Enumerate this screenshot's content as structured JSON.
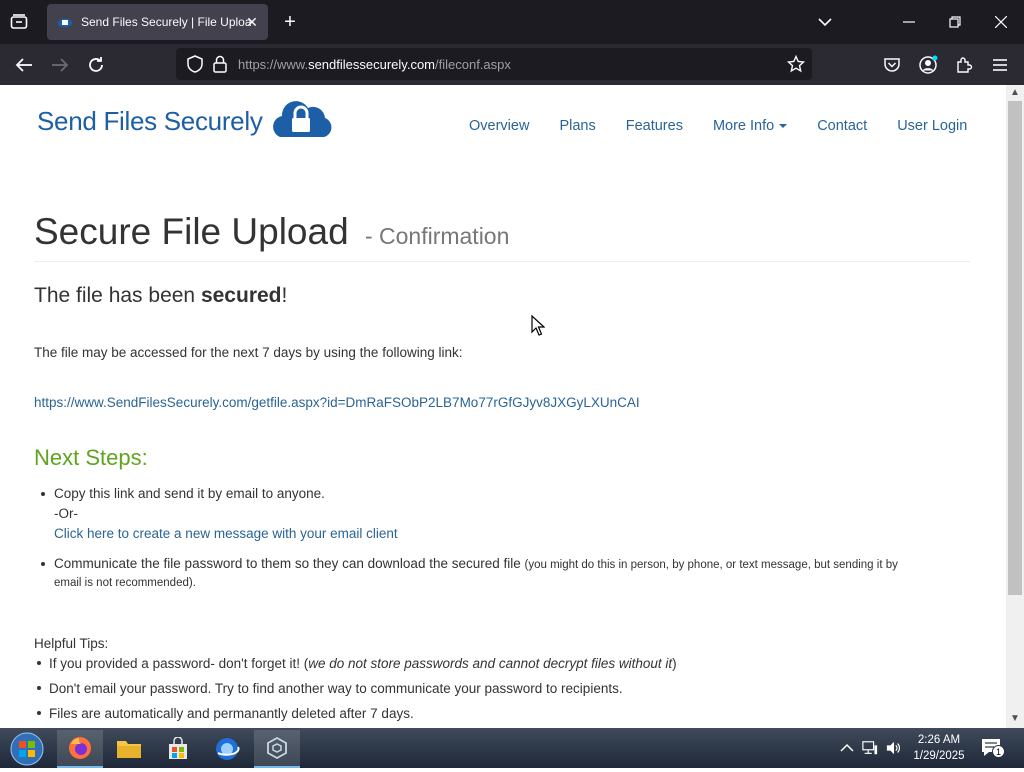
{
  "browser": {
    "tab_title": "Send Files Securely | File Upload",
    "url_prefix": "https://www.",
    "url_domain": "sendfilessecurely.com",
    "url_path": "/fileconf.aspx"
  },
  "site": {
    "logo_text": "Send Files Securely",
    "nav": [
      "Overview",
      "Plans",
      "Features",
      "More Info",
      "Contact",
      "User Login"
    ]
  },
  "page": {
    "title": "Secure File Upload",
    "subtitle": "- Confirmation",
    "heading_pre": "The file has been ",
    "heading_bold": "secured",
    "heading_post": "!",
    "access_text": "The file may be accessed for the next 7 days by using the following link:",
    "file_link": "https://www.SendFilesSecurely.com/getfile.aspx?id=DmRaFSObP2LB7Mo77rGfGJyv8JXGyLXUnCAI",
    "next_steps_heading": "Next Steps:",
    "step1": "Copy this link and send it by email to anyone.",
    "step1_or": "-Or-",
    "step1_link": "Click here to create a new message with your email client",
    "step2_main": "Communicate the file password to them so they can download the secured file",
    "step2_note_line1": "(you might do this in person, by phone, or text message, but sending it by",
    "step2_note_line2": "email is not recommended).",
    "tips_heading": "Helpful Tips:",
    "tip1_pre": "If you provided a password- don't forget it! (",
    "tip1_italic": "we do not store passwords and cannot decrypt files without it",
    "tip1_post": ")",
    "tip2": "Don't email your password. Try to find another way to communicate your password to recipients.",
    "tip3": "Files are automatically and permanantly deleted after 7 days."
  },
  "taskbar": {
    "time": "2:26 AM",
    "date": "1/29/2025",
    "notification_count": "1"
  },
  "colors": {
    "accent_link": "#2a6496",
    "next_steps": "#5fa41f",
    "logo_blue": "#1d5fa6"
  }
}
